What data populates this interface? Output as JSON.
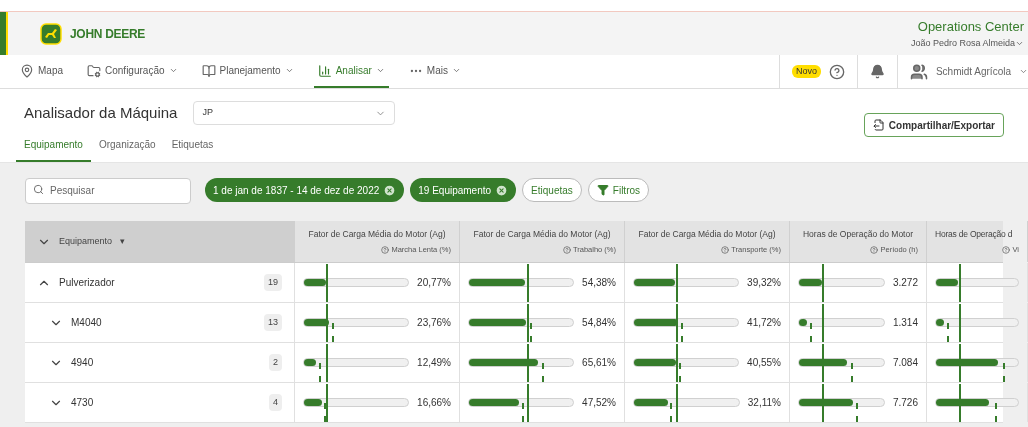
{
  "header": {
    "logo_text": "JOHN DEERE",
    "app_name": "Operations Center",
    "user": "João Pedro Rosa Almeida"
  },
  "nav": {
    "items": [
      {
        "label": "Mapa",
        "dropdown": false,
        "selected": false
      },
      {
        "label": "Configuração",
        "dropdown": true,
        "selected": false
      },
      {
        "label": "Planejamento",
        "dropdown": true,
        "selected": false
      },
      {
        "label": "Analisar",
        "dropdown": true,
        "selected": true
      },
      {
        "label": "Mais",
        "dropdown": true,
        "selected": false
      }
    ],
    "new_badge": "Novo",
    "organization": "Schmidt Agrícola"
  },
  "page": {
    "title": "Analisador da Máquina",
    "selector_value": "JP",
    "share_button": "Compartilhar/Exportar",
    "tabs": [
      {
        "label": "Equipamento",
        "selected": true
      },
      {
        "label": "Organização",
        "selected": false
      },
      {
        "label": "Etiquetas",
        "selected": false
      }
    ]
  },
  "filters": {
    "search_placeholder": "Pesquisar",
    "chips": [
      {
        "label": "1 de jan de 1837 - 14 de dez de 2022",
        "kind": "active"
      },
      {
        "label": "19 Equipamento",
        "kind": "active"
      },
      {
        "label": "Etiquetas",
        "kind": "plain"
      },
      {
        "label": "Filtros",
        "kind": "filter"
      }
    ]
  },
  "table": {
    "first_column": "Equipamento",
    "sort_marker": "▾",
    "columns": [
      {
        "title": "Fator de Carga Média do Motor (Ag)",
        "subtitle": "Marcha Lenta (%)"
      },
      {
        "title": "Fator de Carga Média do Motor (Ag)",
        "subtitle": "Trabalho (%)"
      },
      {
        "title": "Fator de Carga Média do Motor (Ag)",
        "subtitle": "Transporte (%)"
      },
      {
        "title": "Horas de Operação do Motor",
        "subtitle": "Período (h)"
      },
      {
        "title": "Horas de Operação d",
        "subtitle": "Vi"
      }
    ],
    "rows": [
      {
        "name": "Pulverizador",
        "count": "19",
        "expanded": true,
        "cells": [
          {
            "level": 0.21,
            "reading": "20,77%"
          },
          {
            "level": 0.54,
            "reading": "54,38%"
          },
          {
            "level": 0.39,
            "reading": "39,32%"
          },
          {
            "level": 0.27,
            "reading": "3.272"
          },
          {
            "level": 0.27
          }
        ],
        "children": [
          {
            "name": "M4040",
            "count": "13",
            "expanded": false,
            "cells": [
              {
                "level": 0.24,
                "reading": "23,76%"
              },
              {
                "level": 0.55,
                "reading": "54,84%"
              },
              {
                "level": 0.42,
                "reading": "41,72%"
              },
              {
                "level": 0.1,
                "reading": "1.314"
              },
              {
                "level": 0.1
              }
            ]
          },
          {
            "name": "4940",
            "count": "2",
            "expanded": false,
            "cells": [
              {
                "level": 0.12,
                "reading": "12,49%"
              },
              {
                "level": 0.66,
                "reading": "65,61%"
              },
              {
                "level": 0.4,
                "reading": "40,55%"
              },
              {
                "level": 0.57,
                "reading": "7.084"
              },
              {
                "level": 0.75
              }
            ]
          },
          {
            "name": "4730",
            "count": "4",
            "expanded": false,
            "cells": [
              {
                "level": 0.17,
                "reading": "16,66%"
              },
              {
                "level": 0.48,
                "reading": "47,52%"
              },
              {
                "level": 0.32,
                "reading": "32,11%"
              },
              {
                "level": 0.63,
                "reading": "7.726"
              },
              {
                "level": 0.65
              }
            ]
          }
        ]
      }
    ]
  }
}
